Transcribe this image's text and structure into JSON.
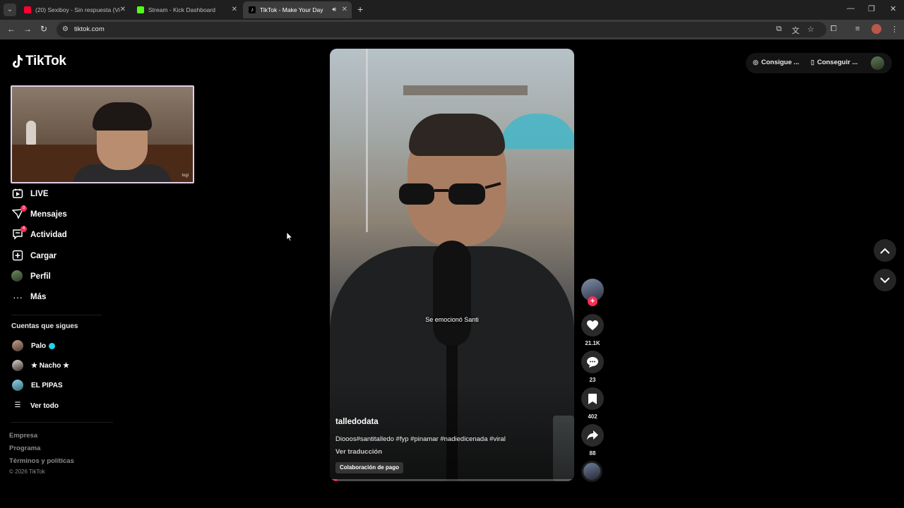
{
  "browser": {
    "tabs": [
      {
        "title": "(20) Sexiboy - Sin respuesta (Vi",
        "favicon_color": "#ff0033",
        "active": false
      },
      {
        "title": "Stream - Kick Dashboard",
        "favicon_color": "#53fc18",
        "active": false
      },
      {
        "title": "TikTok - Make Your Day",
        "favicon_color": "#ffffff",
        "active": true
      }
    ],
    "new_tab": "+",
    "url": "tiktok.com"
  },
  "logo": {
    "text": "TikTok"
  },
  "webcam": {
    "tag": "logi"
  },
  "nav": {
    "items": [
      {
        "label": "LIVE",
        "icon": "live-icon",
        "badge": ""
      },
      {
        "label": "Mensajes",
        "icon": "messages-icon",
        "badge": "3"
      },
      {
        "label": "Actividad",
        "icon": "activity-icon",
        "badge": "4"
      },
      {
        "label": "Cargar",
        "icon": "upload-icon",
        "badge": ""
      },
      {
        "label": "Perfil",
        "icon": "profile-icon",
        "badge": ""
      },
      {
        "label": "Más",
        "icon": "more-icon",
        "badge": ""
      }
    ]
  },
  "following": {
    "title": "Cuentas que sigues",
    "accounts": [
      {
        "name": "Palo",
        "verified": true
      },
      {
        "name": "★ Nacho ★",
        "verified": false
      },
      {
        "name": "EL PIPAS",
        "verified": false
      }
    ],
    "see_all": "Ver todo"
  },
  "footer": {
    "links": [
      "Empresa",
      "Programa",
      "Términos y políticas"
    ],
    "copyright": "© 2026 TikTok"
  },
  "video": {
    "overlay_caption": "Se emocionó Santi",
    "author": "talledodata",
    "description": "Diooos#santitalledo #fyp #pinamar #nadiedicenada #viral",
    "translate": "Ver traducción",
    "paid_label": "Colaboración de pago",
    "progress": 0.03
  },
  "actions": {
    "likes": "21.1K",
    "comments": "23",
    "saves": "402",
    "shares": "88"
  },
  "top_right": {
    "coins_label": "Consigue ...",
    "app_label": "Conseguir ..."
  },
  "colors": {
    "accent": "#fe2c55",
    "verified": "#20d5ec"
  }
}
